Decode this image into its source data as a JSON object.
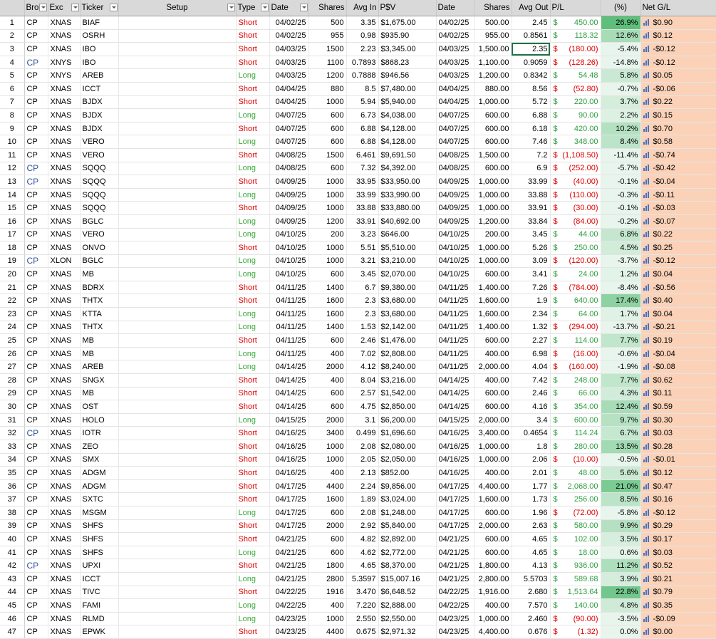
{
  "headers": {
    "num": "",
    "bro": "Bro",
    "exc": "Exc",
    "ticker": "Ticker",
    "setup": "Setup",
    "type": "Type",
    "date": "Date",
    "shares": "Shares",
    "avg_in": "Avg In",
    "psv": "P$V",
    "date2": "Date",
    "shares2": "Shares",
    "avg_out": "Avg Out",
    "pl": "P/L",
    "pct": "(%)",
    "net": "Net G/L"
  },
  "colors": {
    "short": "#e00000",
    "long": "#3cab3c",
    "pl_pos": "#2f9e41",
    "pl_neg": "#e00000",
    "net_bg": "#fbd2b8",
    "pct_pos_strong": "#5cbf7a",
    "pct_neg_bg": "#e8f5ec",
    "bro_blue": "#2f5597"
  },
  "rows": [
    {
      "n": "1",
      "bro": "CP",
      "blue": false,
      "exc": "XNAS",
      "ticker": "BIAF",
      "type": "Short",
      "date": "04/02/25",
      "shares": "500",
      "avg_in": "3.35",
      "psv": "$1,675.00",
      "date2": "04/02/25",
      "shares2": "500.00",
      "avg_out": "2.45",
      "pl": "450.00",
      "pct": "26.9%",
      "net": "$0.90"
    },
    {
      "n": "2",
      "bro": "CP",
      "blue": false,
      "exc": "XNAS",
      "ticker": "OSRH",
      "type": "Short",
      "date": "04/02/25",
      "shares": "955",
      "avg_in": "0.98",
      "psv": "$935.90",
      "date2": "04/02/25",
      "shares2": "955.00",
      "avg_out": "0.8561",
      "pl": "118.32",
      "pct": "12.6%",
      "net": "$0.12"
    },
    {
      "n": "3",
      "bro": "CP",
      "blue": false,
      "exc": "XNAS",
      "ticker": "IBO",
      "type": "Short",
      "date": "04/03/25",
      "shares": "1500",
      "avg_in": "2.23",
      "psv": "$3,345.00",
      "date2": "04/03/25",
      "shares2": "1,500.00",
      "avg_out": "2.35",
      "pl": "(180.00)",
      "pct": "-5.4%",
      "net": "-$0.12"
    },
    {
      "n": "4",
      "bro": "CP",
      "blue": true,
      "exc": "XNYS",
      "ticker": "IBO",
      "type": "Short",
      "date": "04/03/25",
      "shares": "1100",
      "avg_in": "0.7893",
      "psv": "$868.23",
      "date2": "04/03/25",
      "shares2": "1,100.00",
      "avg_out": "0.9059",
      "pl": "(128.26)",
      "pct": "-14.8%",
      "net": "-$0.12"
    },
    {
      "n": "5",
      "bro": "CP",
      "blue": false,
      "exc": "XNYS",
      "ticker": "AREB",
      "type": "Long",
      "date": "04/03/25",
      "shares": "1200",
      "avg_in": "0.7888",
      "psv": "$946.56",
      "date2": "04/03/25",
      "shares2": "1,200.00",
      "avg_out": "0.8342",
      "pl": "54.48",
      "pct": "5.8%",
      "net": "$0.05"
    },
    {
      "n": "6",
      "bro": "CP",
      "blue": false,
      "exc": "XNAS",
      "ticker": "ICCT",
      "type": "Short",
      "date": "04/04/25",
      "shares": "880",
      "avg_in": "8.5",
      "psv": "$7,480.00",
      "date2": "04/04/25",
      "shares2": "880.00",
      "avg_out": "8.56",
      "pl": "(52.80)",
      "pct": "-0.7%",
      "net": "-$0.06"
    },
    {
      "n": "7",
      "bro": "CP",
      "blue": false,
      "exc": "XNAS",
      "ticker": "BJDX",
      "type": "Short",
      "date": "04/04/25",
      "shares": "1000",
      "avg_in": "5.94",
      "psv": "$5,940.00",
      "date2": "04/04/25",
      "shares2": "1,000.00",
      "avg_out": "5.72",
      "pl": "220.00",
      "pct": "3.7%",
      "net": "$0.22"
    },
    {
      "n": "8",
      "bro": "CP",
      "blue": false,
      "exc": "XNAS",
      "ticker": "BJDX",
      "type": "Long",
      "date": "04/07/25",
      "shares": "600",
      "avg_in": "6.73",
      "psv": "$4,038.00",
      "date2": "04/07/25",
      "shares2": "600.00",
      "avg_out": "6.88",
      "pl": "90.00",
      "pct": "2.2%",
      "net": "$0.15"
    },
    {
      "n": "9",
      "bro": "CP",
      "blue": false,
      "exc": "XNAS",
      "ticker": "BJDX",
      "type": "Short",
      "date": "04/07/25",
      "shares": "600",
      "avg_in": "6.88",
      "psv": "$4,128.00",
      "date2": "04/07/25",
      "shares2": "600.00",
      "avg_out": "6.18",
      "pl": "420.00",
      "pct": "10.2%",
      "net": "$0.70"
    },
    {
      "n": "10",
      "bro": "CP",
      "blue": false,
      "exc": "XNAS",
      "ticker": "VERO",
      "type": "Long",
      "date": "04/07/25",
      "shares": "600",
      "avg_in": "6.88",
      "psv": "$4,128.00",
      "date2": "04/07/25",
      "shares2": "600.00",
      "avg_out": "7.46",
      "pl": "348.00",
      "pct": "8.4%",
      "net": "$0.58"
    },
    {
      "n": "11",
      "bro": "CP",
      "blue": false,
      "exc": "XNAS",
      "ticker": "VERO",
      "type": "Short",
      "date": "04/08/25",
      "shares": "1500",
      "avg_in": "6.461",
      "psv": "$9,691.50",
      "date2": "04/08/25",
      "shares2": "1,500.00",
      "avg_out": "7.2",
      "pl": "(1,108.50)",
      "pct": "-11.4%",
      "net": "-$0.74"
    },
    {
      "n": "12",
      "bro": "CP",
      "blue": true,
      "exc": "XNAS",
      "ticker": "SQQQ",
      "type": "Long",
      "date": "04/08/25",
      "shares": "600",
      "avg_in": "7.32",
      "psv": "$4,392.00",
      "date2": "04/08/25",
      "shares2": "600.00",
      "avg_out": "6.9",
      "pl": "(252.00)",
      "pct": "-5.7%",
      "net": "-$0.42"
    },
    {
      "n": "13",
      "bro": "CP",
      "blue": true,
      "exc": "XNAS",
      "ticker": "SQQQ",
      "type": "Short",
      "date": "04/09/25",
      "shares": "1000",
      "avg_in": "33.95",
      "psv": "$33,950.00",
      "date2": "04/09/25",
      "shares2": "1,000.00",
      "avg_out": "33.99",
      "pl": "(40.00)",
      "pct": "-0.1%",
      "net": "-$0.04"
    },
    {
      "n": "14",
      "bro": "CP",
      "blue": false,
      "exc": "XNAS",
      "ticker": "SQQQ",
      "type": "Long",
      "date": "04/09/25",
      "shares": "1000",
      "avg_in": "33.99",
      "psv": "$33,990.00",
      "date2": "04/09/25",
      "shares2": "1,000.00",
      "avg_out": "33.88",
      "pl": "(110.00)",
      "pct": "-0.3%",
      "net": "-$0.11"
    },
    {
      "n": "15",
      "bro": "CP",
      "blue": false,
      "exc": "XNAS",
      "ticker": "SQQQ",
      "type": "Short",
      "date": "04/09/25",
      "shares": "1000",
      "avg_in": "33.88",
      "psv": "$33,880.00",
      "date2": "04/09/25",
      "shares2": "1,000.00",
      "avg_out": "33.91",
      "pl": "(30.00)",
      "pct": "-0.1%",
      "net": "-$0.03"
    },
    {
      "n": "16",
      "bro": "CP",
      "blue": false,
      "exc": "XNAS",
      "ticker": "BGLC",
      "type": "Long",
      "date": "04/09/25",
      "shares": "1200",
      "avg_in": "33.91",
      "psv": "$40,692.00",
      "date2": "04/09/25",
      "shares2": "1,200.00",
      "avg_out": "33.84",
      "pl": "(84.00)",
      "pct": "-0.2%",
      "net": "-$0.07"
    },
    {
      "n": "17",
      "bro": "CP",
      "blue": false,
      "exc": "XNAS",
      "ticker": "VERO",
      "type": "Long",
      "date": "04/10/25",
      "shares": "200",
      "avg_in": "3.23",
      "psv": "$646.00",
      "date2": "04/10/25",
      "shares2": "200.00",
      "avg_out": "3.45",
      "pl": "44.00",
      "pct": "6.8%",
      "net": "$0.22"
    },
    {
      "n": "18",
      "bro": "CP",
      "blue": false,
      "exc": "XNAS",
      "ticker": "ONVO",
      "type": "Short",
      "date": "04/10/25",
      "shares": "1000",
      "avg_in": "5.51",
      "psv": "$5,510.00",
      "date2": "04/10/25",
      "shares2": "1,000.00",
      "avg_out": "5.26",
      "pl": "250.00",
      "pct": "4.5%",
      "net": "$0.25"
    },
    {
      "n": "19",
      "bro": "CP",
      "blue": true,
      "exc": "XLON",
      "ticker": "BGLC",
      "type": "Long",
      "date": "04/10/25",
      "shares": "1000",
      "avg_in": "3.21",
      "psv": "$3,210.00",
      "date2": "04/10/25",
      "shares2": "1,000.00",
      "avg_out": "3.09",
      "pl": "(120.00)",
      "pct": "-3.7%",
      "net": "-$0.12"
    },
    {
      "n": "20",
      "bro": "CP",
      "blue": false,
      "exc": "XNAS",
      "ticker": "MB",
      "type": "Long",
      "date": "04/10/25",
      "shares": "600",
      "avg_in": "3.45",
      "psv": "$2,070.00",
      "date2": "04/10/25",
      "shares2": "600.00",
      "avg_out": "3.41",
      "pl": "24.00",
      "pct": "1.2%",
      "net": "$0.04"
    },
    {
      "n": "21",
      "bro": "CP",
      "blue": false,
      "exc": "XNAS",
      "ticker": "BDRX",
      "type": "Short",
      "date": "04/11/25",
      "shares": "1400",
      "avg_in": "6.7",
      "psv": "$9,380.00",
      "date2": "04/11/25",
      "shares2": "1,400.00",
      "avg_out": "7.26",
      "pl": "(784.00)",
      "pct": "-8.4%",
      "net": "-$0.56"
    },
    {
      "n": "22",
      "bro": "CP",
      "blue": false,
      "exc": "XNAS",
      "ticker": "THTX",
      "type": "Short",
      "date": "04/11/25",
      "shares": "1600",
      "avg_in": "2.3",
      "psv": "$3,680.00",
      "date2": "04/11/25",
      "shares2": "1,600.00",
      "avg_out": "1.9",
      "pl": "640.00",
      "pct": "17.4%",
      "net": "$0.40"
    },
    {
      "n": "23",
      "bro": "CP",
      "blue": false,
      "exc": "XNAS",
      "ticker": "KTTA",
      "type": "Long",
      "date": "04/11/25",
      "shares": "1600",
      "avg_in": "2.3",
      "psv": "$3,680.00",
      "date2": "04/11/25",
      "shares2": "1,600.00",
      "avg_out": "2.34",
      "pl": "64.00",
      "pct": "1.7%",
      "net": "$0.04"
    },
    {
      "n": "24",
      "bro": "CP",
      "blue": false,
      "exc": "XNAS",
      "ticker": "THTX",
      "type": "Long",
      "date": "04/11/25",
      "shares": "1400",
      "avg_in": "1.53",
      "psv": "$2,142.00",
      "date2": "04/11/25",
      "shares2": "1,400.00",
      "avg_out": "1.32",
      "pl": "(294.00)",
      "pct": "-13.7%",
      "net": "-$0.21"
    },
    {
      "n": "25",
      "bro": "CP",
      "blue": false,
      "exc": "XNAS",
      "ticker": "MB",
      "type": "Short",
      "date": "04/11/25",
      "shares": "600",
      "avg_in": "2.46",
      "psv": "$1,476.00",
      "date2": "04/11/25",
      "shares2": "600.00",
      "avg_out": "2.27",
      "pl": "114.00",
      "pct": "7.7%",
      "net": "$0.19"
    },
    {
      "n": "26",
      "bro": "CP",
      "blue": false,
      "exc": "XNAS",
      "ticker": "MB",
      "type": "Long",
      "date": "04/11/25",
      "shares": "400",
      "avg_in": "7.02",
      "psv": "$2,808.00",
      "date2": "04/11/25",
      "shares2": "400.00",
      "avg_out": "6.98",
      "pl": "(16.00)",
      "pct": "-0.6%",
      "net": "-$0.04"
    },
    {
      "n": "27",
      "bro": "CP",
      "blue": false,
      "exc": "XNAS",
      "ticker": "AREB",
      "type": "Long",
      "date": "04/14/25",
      "shares": "2000",
      "avg_in": "4.12",
      "psv": "$8,240.00",
      "date2": "04/11/25",
      "shares2": "2,000.00",
      "avg_out": "4.04",
      "pl": "(160.00)",
      "pct": "-1.9%",
      "net": "-$0.08"
    },
    {
      "n": "28",
      "bro": "CP",
      "blue": false,
      "exc": "XNAS",
      "ticker": "SNGX",
      "type": "Short",
      "date": "04/14/25",
      "shares": "400",
      "avg_in": "8.04",
      "psv": "$3,216.00",
      "date2": "04/14/25",
      "shares2": "400.00",
      "avg_out": "7.42",
      "pl": "248.00",
      "pct": "7.7%",
      "net": "$0.62"
    },
    {
      "n": "29",
      "bro": "CP",
      "blue": false,
      "exc": "XNAS",
      "ticker": "MB",
      "type": "Short",
      "date": "04/14/25",
      "shares": "600",
      "avg_in": "2.57",
      "psv": "$1,542.00",
      "date2": "04/14/25",
      "shares2": "600.00",
      "avg_out": "2.46",
      "pl": "66.00",
      "pct": "4.3%",
      "net": "$0.11"
    },
    {
      "n": "30",
      "bro": "CP",
      "blue": false,
      "exc": "XNAS",
      "ticker": "OST",
      "type": "Short",
      "date": "04/14/25",
      "shares": "600",
      "avg_in": "4.75",
      "psv": "$2,850.00",
      "date2": "04/14/25",
      "shares2": "600.00",
      "avg_out": "4.16",
      "pl": "354.00",
      "pct": "12.4%",
      "net": "$0.59"
    },
    {
      "n": "31",
      "bro": "CP",
      "blue": false,
      "exc": "XNAS",
      "ticker": "HOLO",
      "type": "Long",
      "date": "04/15/25",
      "shares": "2000",
      "avg_in": "3.1",
      "psv": "$6,200.00",
      "date2": "04/15/25",
      "shares2": "2,000.00",
      "avg_out": "3.4",
      "pl": "600.00",
      "pct": "9.7%",
      "net": "$0.30"
    },
    {
      "n": "32",
      "bro": "CP",
      "blue": true,
      "exc": "XNAS",
      "ticker": "IOTR",
      "type": "Short",
      "date": "04/16/25",
      "shares": "3400",
      "avg_in": "0.499",
      "psv": "$1,696.60",
      "date2": "04/16/25",
      "shares2": "3,400.00",
      "avg_out": "0.4654",
      "pl": "114.24",
      "pct": "6.7%",
      "net": "$0.03"
    },
    {
      "n": "33",
      "bro": "CP",
      "blue": false,
      "exc": "XNAS",
      "ticker": "ZEO",
      "type": "Short",
      "date": "04/16/25",
      "shares": "1000",
      "avg_in": "2.08",
      "psv": "$2,080.00",
      "date2": "04/16/25",
      "shares2": "1,000.00",
      "avg_out": "1.8",
      "pl": "280.00",
      "pct": "13.5%",
      "net": "$0.28"
    },
    {
      "n": "34",
      "bro": "CP",
      "blue": false,
      "exc": "XNAS",
      "ticker": "SMX",
      "type": "Short",
      "date": "04/16/25",
      "shares": "1000",
      "avg_in": "2.05",
      "psv": "$2,050.00",
      "date2": "04/16/25",
      "shares2": "1,000.00",
      "avg_out": "2.06",
      "pl": "(10.00)",
      "pct": "-0.5%",
      "net": "-$0.01"
    },
    {
      "n": "35",
      "bro": "CP",
      "blue": false,
      "exc": "XNAS",
      "ticker": "ADGM",
      "type": "Short",
      "date": "04/16/25",
      "shares": "400",
      "avg_in": "2.13",
      "psv": "$852.00",
      "date2": "04/16/25",
      "shares2": "400.00",
      "avg_out": "2.01",
      "pl": "48.00",
      "pct": "5.6%",
      "net": "$0.12"
    },
    {
      "n": "36",
      "bro": "CP",
      "blue": false,
      "exc": "XNAS",
      "ticker": "ADGM",
      "type": "Short",
      "date": "04/17/25",
      "shares": "4400",
      "avg_in": "2.24",
      "psv": "$9,856.00",
      "date2": "04/17/25",
      "shares2": "4,400.00",
      "avg_out": "1.77",
      "pl": "2,068.00",
      "pct": "21.0%",
      "net": "$0.47"
    },
    {
      "n": "37",
      "bro": "CP",
      "blue": false,
      "exc": "XNAS",
      "ticker": "SXTC",
      "type": "Short",
      "date": "04/17/25",
      "shares": "1600",
      "avg_in": "1.89",
      "psv": "$3,024.00",
      "date2": "04/17/25",
      "shares2": "1,600.00",
      "avg_out": "1.73",
      "pl": "256.00",
      "pct": "8.5%",
      "net": "$0.16"
    },
    {
      "n": "38",
      "bro": "CP",
      "blue": false,
      "exc": "XNAS",
      "ticker": "MSGM",
      "type": "Long",
      "date": "04/17/25",
      "shares": "600",
      "avg_in": "2.08",
      "psv": "$1,248.00",
      "date2": "04/17/25",
      "shares2": "600.00",
      "avg_out": "1.96",
      "pl": "(72.00)",
      "pct": "-5.8%",
      "net": "-$0.12"
    },
    {
      "n": "39",
      "bro": "CP",
      "blue": false,
      "exc": "XNAS",
      "ticker": "SHFS",
      "type": "Short",
      "date": "04/17/25",
      "shares": "2000",
      "avg_in": "2.92",
      "psv": "$5,840.00",
      "date2": "04/17/25",
      "shares2": "2,000.00",
      "avg_out": "2.63",
      "pl": "580.00",
      "pct": "9.9%",
      "net": "$0.29"
    },
    {
      "n": "40",
      "bro": "CP",
      "blue": false,
      "exc": "XNAS",
      "ticker": "SHFS",
      "type": "Short",
      "date": "04/21/25",
      "shares": "600",
      "avg_in": "4.82",
      "psv": "$2,892.00",
      "date2": "04/21/25",
      "shares2": "600.00",
      "avg_out": "4.65",
      "pl": "102.00",
      "pct": "3.5%",
      "net": "$0.17"
    },
    {
      "n": "41",
      "bro": "CP",
      "blue": false,
      "exc": "XNAS",
      "ticker": "SHFS",
      "type": "Long",
      "date": "04/21/25",
      "shares": "600",
      "avg_in": "4.62",
      "psv": "$2,772.00",
      "date2": "04/21/25",
      "shares2": "600.00",
      "avg_out": "4.65",
      "pl": "18.00",
      "pct": "0.6%",
      "net": "$0.03"
    },
    {
      "n": "42",
      "bro": "CP",
      "blue": true,
      "exc": "XNAS",
      "ticker": "UPXI",
      "type": "Short",
      "date": "04/21/25",
      "shares": "1800",
      "avg_in": "4.65",
      "psv": "$8,370.00",
      "date2": "04/21/25",
      "shares2": "1,800.00",
      "avg_out": "4.13",
      "pl": "936.00",
      "pct": "11.2%",
      "net": "$0.52"
    },
    {
      "n": "43",
      "bro": "CP",
      "blue": false,
      "exc": "XNAS",
      "ticker": "ICCT",
      "type": "Long",
      "date": "04/21/25",
      "shares": "2800",
      "avg_in": "5.3597",
      "psv": "$15,007.16",
      "date2": "04/21/25",
      "shares2": "2,800.00",
      "avg_out": "5.5703",
      "pl": "589.68",
      "pct": "3.9%",
      "net": "$0.21"
    },
    {
      "n": "44",
      "bro": "CP",
      "blue": false,
      "exc": "XNAS",
      "ticker": "TIVC",
      "type": "Short",
      "date": "04/22/25",
      "shares": "1916",
      "avg_in": "3.470",
      "psv": "$6,648.52",
      "date2": "04/22/25",
      "shares2": "1,916.00",
      "avg_out": "2.680",
      "pl": "1,513.64",
      "pct": "22.8%",
      "net": "$0.79"
    },
    {
      "n": "45",
      "bro": "CP",
      "blue": false,
      "exc": "XNAS",
      "ticker": "FAMI",
      "type": "Long",
      "date": "04/22/25",
      "shares": "400",
      "avg_in": "7.220",
      "psv": "$2,888.00",
      "date2": "04/22/25",
      "shares2": "400.00",
      "avg_out": "7.570",
      "pl": "140.00",
      "pct": "4.8%",
      "net": "$0.35"
    },
    {
      "n": "46",
      "bro": "CP",
      "blue": false,
      "exc": "XNAS",
      "ticker": "RLMD",
      "type": "Long",
      "date": "04/23/25",
      "shares": "1000",
      "avg_in": "2.550",
      "psv": "$2,550.00",
      "date2": "04/23/25",
      "shares2": "1,000.00",
      "avg_out": "2.460",
      "pl": "(90.00)",
      "pct": "-3.5%",
      "net": "-$0.09"
    },
    {
      "n": "47",
      "bro": "CP",
      "blue": false,
      "exc": "XNAS",
      "ticker": "EPWK",
      "type": "Short",
      "date": "04/23/25",
      "shares": "4400",
      "avg_in": "0.675",
      "psv": "$2,971.32",
      "date2": "04/23/25",
      "shares2": "4,400.00",
      "avg_out": "0.676",
      "pl": "(1.32)",
      "pct": "0.0%",
      "net": "$0.00"
    }
  ],
  "selected_cell": {
    "row": "3",
    "column": "avg_out"
  }
}
